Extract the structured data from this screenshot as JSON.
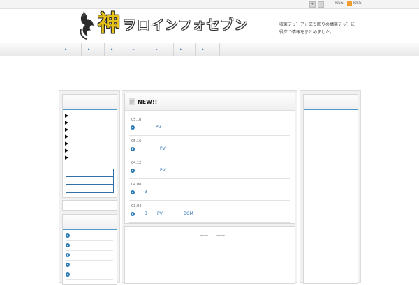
{
  "topbar": {
    "rss1": "RSS",
    "rss2": "RSS"
  },
  "logo": {
    "kanji": "神",
    "kana": "ヲロインフォセブン"
  },
  "tagline": {
    "line1": "収束デッ゛ア」立ち回りの構築デッ゛に",
    "line2": "役立つ情報をまとめました。"
  },
  "nav": {
    "arrow": "►"
  },
  "sidebar": {
    "triangle": "▶"
  },
  "news": {
    "title": "NEW!!",
    "items": [
      {
        "date": "05.18",
        "text": "PV"
      },
      {
        "date": "05.16",
        "text": "PV"
      },
      {
        "date": "04.12",
        "text": "PV"
      },
      {
        "date": "04.08",
        "text": "3"
      },
      {
        "date": "03.04",
        "text": "3",
        "text2": "PV",
        "text3": "BGM"
      }
    ]
  },
  "lower": {
    "dash1": "——",
    "dash2": "——"
  },
  "colors": {
    "accent": "#4f9ac9",
    "link": "#2b6fb0",
    "logo_gold": "#e6c21a"
  },
  "icons": {
    "rss": "rss-icon",
    "bullet": "circle-arrow-icon"
  }
}
